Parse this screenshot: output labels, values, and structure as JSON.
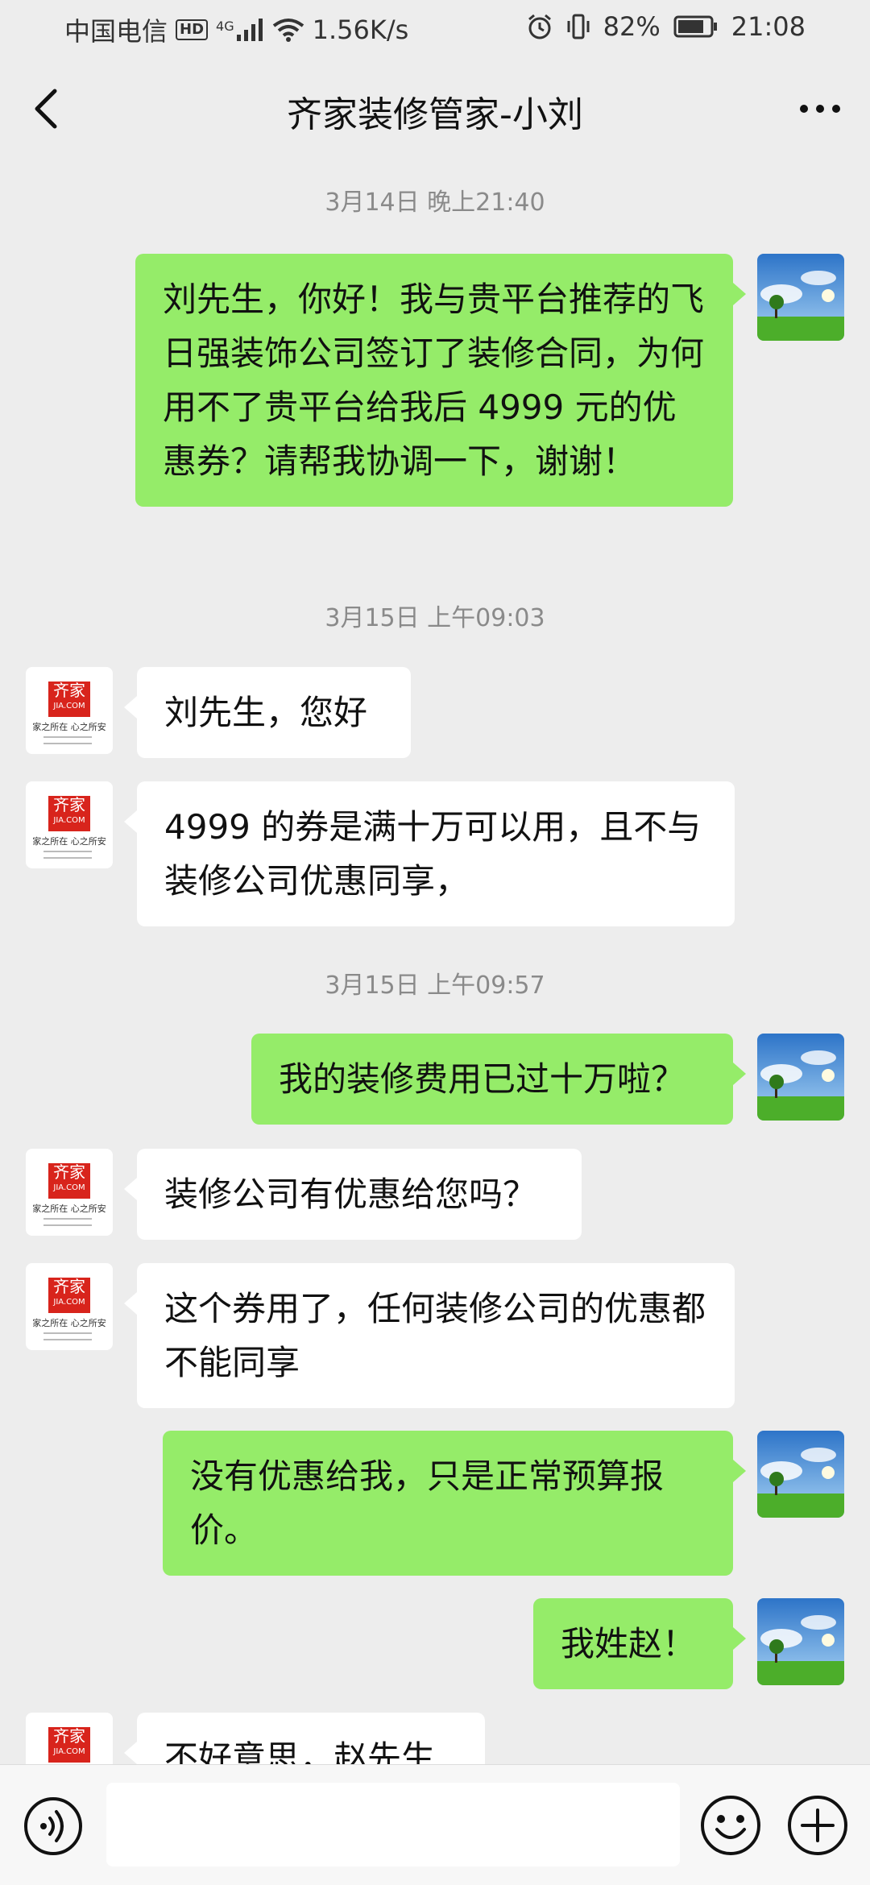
{
  "status_bar": {
    "carrier": "中国电信",
    "hd": "HD",
    "network": "4G",
    "speed": "1.56K/s",
    "battery": "82%",
    "time": "21:08"
  },
  "header": {
    "title": "齐家装修管家-小刘"
  },
  "avatars": {
    "other_logo_main": "齐家",
    "other_logo_sub": "JIA.COM",
    "other_slogan": "家之所在 心之所安"
  },
  "messages": [
    {
      "type": "time",
      "text": "3月14日 晚上21:40"
    },
    {
      "type": "me",
      "text": "刘先生，你好！我与贵平台推荐的飞日强装饰公司签订了装修合同，为何用不了贵平台给我后 4999 元的优惠券？请帮我协调一下，谢谢！"
    },
    {
      "type": "time",
      "text": "3月15日 上午09:03"
    },
    {
      "type": "other",
      "text": "刘先生，您好"
    },
    {
      "type": "other",
      "text": "4999 的券是满十万可以用，且不与装修公司优惠同享，"
    },
    {
      "type": "time",
      "text": "3月15日 上午09:57"
    },
    {
      "type": "me",
      "text": "我的装修费用已过十万啦？"
    },
    {
      "type": "other",
      "text": "装修公司有优惠给您吗？"
    },
    {
      "type": "other",
      "text": "这个券用了，任何装修公司的优惠都不能同享"
    },
    {
      "type": "me",
      "text": "没有优惠给我，只是正常预算报价。"
    },
    {
      "type": "me",
      "text": "我姓赵！"
    },
    {
      "type": "other",
      "text": "不好意思，赵先生"
    }
  ],
  "input_bar": {
    "value": "",
    "icons": [
      "voice-icon",
      "emoji-icon",
      "plus-icon"
    ]
  },
  "colors": {
    "background": "#ededed",
    "my_bubble": "#95ec69",
    "other_bubble": "#ffffff",
    "timestamp": "#8a8a8a",
    "brand_red": "#d8241c"
  }
}
